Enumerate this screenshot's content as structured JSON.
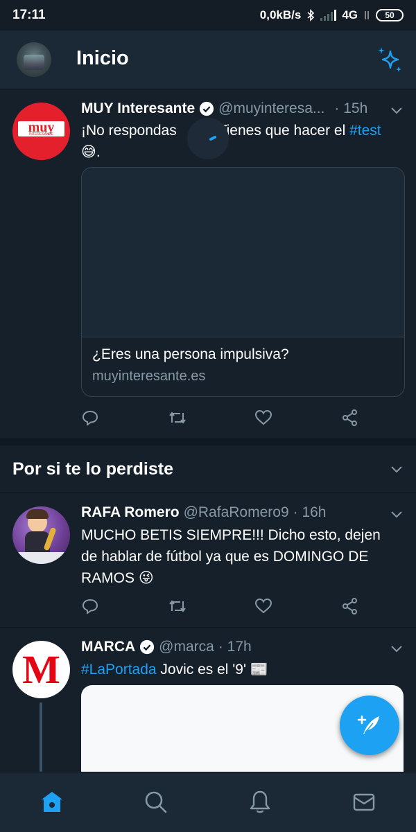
{
  "status_bar": {
    "time": "17:11",
    "speed": "0,0kB/s",
    "network": "4G",
    "battery": "50"
  },
  "header": {
    "title": "Inicio"
  },
  "tweets": [
    {
      "name": "MUY Interesante",
      "handle": "@muyinteresa...",
      "time": "· 15h",
      "avatar_text": "muy",
      "avatar_subtext": "INTERESANTE",
      "text_before": "¡No respondas ",
      "text_after": "Tienes que hacer el ",
      "hashtag": "#test",
      "emoji": "😅",
      "trailing": ".",
      "card": {
        "title": "¿Eres una persona impulsiva?",
        "domain": "muyinteresante.es"
      }
    },
    {
      "name": "RAFA Romero",
      "handle": "@RafaRomero9",
      "time": "· 16h",
      "text_line1": "MUCHO BETIS SIEMPRE!!! Dicho esto, dejen",
      "text_line2": "de hablar de fútbol ya que es DOMINGO DE",
      "text_line3": "RAMOS ",
      "emoji": "😜"
    },
    {
      "name": "MARCA",
      "handle": "@marca",
      "time": "· 17h",
      "avatar_text": "M",
      "hashtag": "#LaPortada",
      "text": " Jovic es el '9' ",
      "emoji": "📰"
    }
  ],
  "section": {
    "title": "Por si te lo perdiste"
  },
  "colors": {
    "background": "#15202b",
    "accent": "#1da1f2",
    "muted": "#8899a6",
    "muy_red": "#e3202c",
    "marca_red": "#e30613"
  },
  "icons": {
    "sparkle": "sparkle-icon",
    "compose": "compose-tweet-icon",
    "home": "home-icon",
    "search": "search-icon",
    "notifications": "bell-icon",
    "messages": "mail-icon"
  }
}
